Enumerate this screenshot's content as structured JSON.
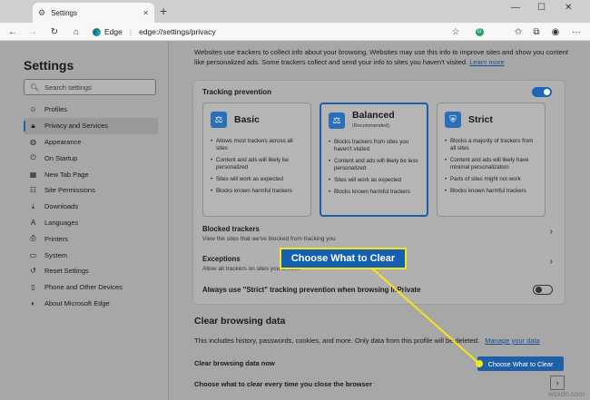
{
  "tab": {
    "title": "Settings",
    "close": "✕",
    "new_tab": "+"
  },
  "window_controls": {
    "minimize": "—",
    "maximize": "☐",
    "close": "✕"
  },
  "toolbar": {
    "site_name": "Edge",
    "separator": "|",
    "url": "edge://settings/privacy"
  },
  "sidebar": {
    "title": "Settings",
    "search_placeholder": "Search settings",
    "items": [
      {
        "label": "Profiles",
        "icon": "person-icon"
      },
      {
        "label": "Privacy and Services",
        "icon": "lock-icon",
        "active": true
      },
      {
        "label": "Appearance",
        "icon": "palette-icon"
      },
      {
        "label": "On Startup",
        "icon": "power-icon"
      },
      {
        "label": "New Tab Page",
        "icon": "grid-icon"
      },
      {
        "label": "Site Permissions",
        "icon": "sliders-icon"
      },
      {
        "label": "Downloads",
        "icon": "download-icon"
      },
      {
        "label": "Languages",
        "icon": "language-icon"
      },
      {
        "label": "Printers",
        "icon": "printer-icon"
      },
      {
        "label": "System",
        "icon": "laptop-icon"
      },
      {
        "label": "Reset Settings",
        "icon": "reset-icon"
      },
      {
        "label": "Phone and Other Devices",
        "icon": "phone-icon"
      },
      {
        "label": "About Microsoft Edge",
        "icon": "edge-logo-icon"
      }
    ]
  },
  "main": {
    "intro_text": "Websites use trackers to collect info about your browsing. Websites may use this info to improve sites and show you content like personalized ads. Some trackers collect and send your info to sites you haven't visited.",
    "intro_link": "Learn more",
    "tracking": {
      "title": "Tracking prevention",
      "options": [
        {
          "name": "Basic",
          "sub": "",
          "points": [
            "Allows most trackers across all sites",
            "Content and ads will likely be personalized",
            "Sites will work as expected",
            "Blocks known harmful trackers"
          ]
        },
        {
          "name": "Balanced",
          "sub": "(Recommended)",
          "points": [
            "Blocks trackers from sites you haven't visited",
            "Content and ads will likely be less personalized",
            "Sites will work as expected",
            "Blocks known harmful trackers"
          ]
        },
        {
          "name": "Strict",
          "sub": "",
          "points": [
            "Blocks a majority of trackers from all sites",
            "Content and ads will likely have minimal personalization",
            "Parts of sites might not work",
            "Blocks known harmful trackers"
          ]
        }
      ],
      "blocked_title": "Blocked trackers",
      "blocked_sub": "View the sites that we've blocked from tracking you",
      "exceptions_title": "Exceptions",
      "exceptions_sub": "Allow all trackers on sites you choose",
      "inprivate_label": "Always use \"Strict\" tracking prevention when browsing InPrivate"
    },
    "clear": {
      "title": "Clear browsing data",
      "desc": "This includes history, passwords, cookies, and more. Only data from this profile will be deleted.",
      "desc_link": "Manage your data",
      "now_label": "Clear browsing data now",
      "button_label": "Choose What to Clear",
      "every_label": "Choose what to clear every time you close the browser"
    }
  },
  "callout": {
    "text": "Choose What to Clear",
    "border_color": "#f5e51b",
    "fill_color": "#1560b0"
  },
  "watermark": "wsxdn.com",
  "colors": {
    "accent": "#1e5fa8",
    "highlight": "#f5e51b"
  }
}
